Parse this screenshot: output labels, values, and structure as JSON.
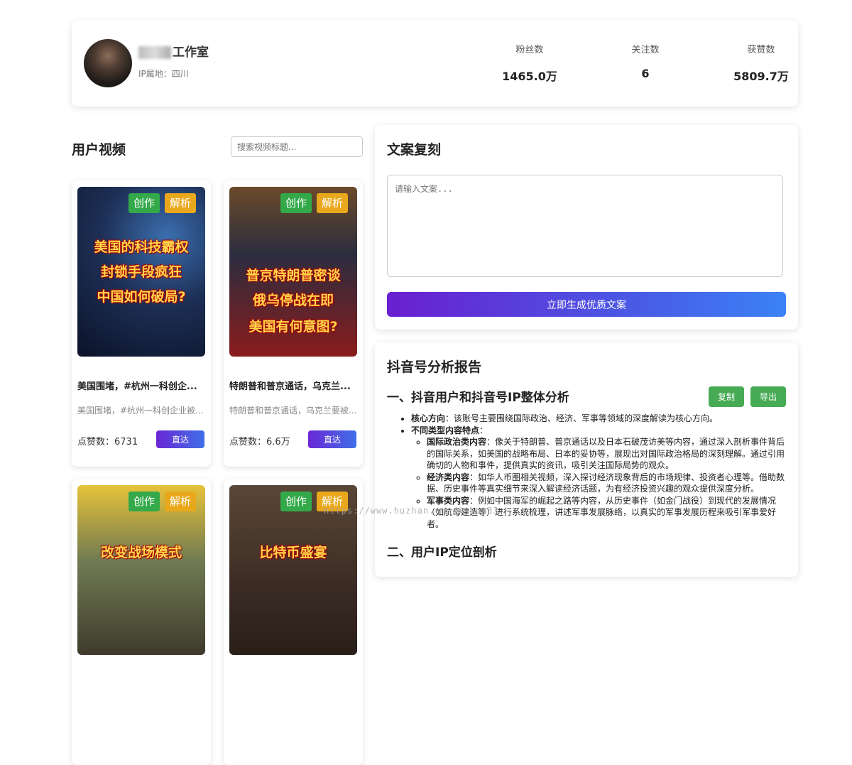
{
  "profile": {
    "name": "工作室",
    "ip": "IP属地：四川",
    "stats": [
      {
        "label": "粉丝数",
        "value": "1465.0万"
      },
      {
        "label": "关注数",
        "value": "6"
      },
      {
        "label": "获赞数",
        "value": "5809.7万"
      }
    ]
  },
  "videos": {
    "title": "用户视频",
    "search_placeholder": "搜索视频标题...",
    "badge_create": "创作",
    "badge_parse": "解析",
    "likes_prefix": "点赞数：",
    "go_label": "直达",
    "items": [
      {
        "caption": [
          "美国的科技霸权",
          "封锁手段疯狂",
          "中国如何破局?"
        ],
        "title": "美国围堵，#杭州一科创企...",
        "desc": "美国围堵，#杭州一科创企业被...",
        "likes": "点赞数：6731"
      },
      {
        "caption": [
          "普京特朗普密谈",
          "俄乌停战在即",
          "美国有何意图?"
        ],
        "title": "特朗普和普京通话，乌克兰...",
        "desc": "特朗普和普京通话，乌克兰要被...",
        "likes": "点赞数：6.6万"
      },
      {
        "caption": [
          "改变战场模式"
        ],
        "title": "",
        "desc": "",
        "likes": ""
      },
      {
        "caption": [
          "比特币盛宴"
        ],
        "title": "",
        "desc": "",
        "likes": ""
      }
    ]
  },
  "copywrite": {
    "title": "文案复刻",
    "placeholder": "请输入文案...",
    "button": "立即生成优质文案"
  },
  "report": {
    "title": "抖音号分析报告",
    "section1": "一、抖音用户和抖音号IP整体分析",
    "copy_btn": "复制",
    "export_btn": "导出",
    "core_label": "核心方向",
    "core_text": "：该账号主要围绕国际政治、经济、军事等领域的深度解读为核心方向。",
    "types_label": "不同类型内容特点",
    "types_colon": "：",
    "sub": [
      {
        "label": "国际政治类内容",
        "text": "：像关于特朗普、普京通话以及日本石破茂访美等内容，通过深入剖析事件背后的国际关系，如美国的战略布局、日本的妥协等，展现出对国际政治格局的深刻理解。通过引用确切的人物和事件，提供真实的资讯，吸引关注国际局势的观众。"
      },
      {
        "label": "经济类内容",
        "text": "：如华人币圈相关视频，深入探讨经济现象背后的市场规律、投资者心理等。借助数据、历史事件等真实细节来深入解读经济话题，为有经济投资兴趣的观众提供深度分析。"
      },
      {
        "label": "军事类内容",
        "text": "：例如中国海军的崛起之路等内容，从历史事件（如金门战役）到现代的发展情况（如航母建造等）进行系统梳理，讲述军事发展脉络，以真实的军事发展历程来吸引军事爱好者。"
      }
    ],
    "section2": "二、用户IP定位剖析"
  },
  "watermark": "https://www.huzhan.com/ishop33"
}
